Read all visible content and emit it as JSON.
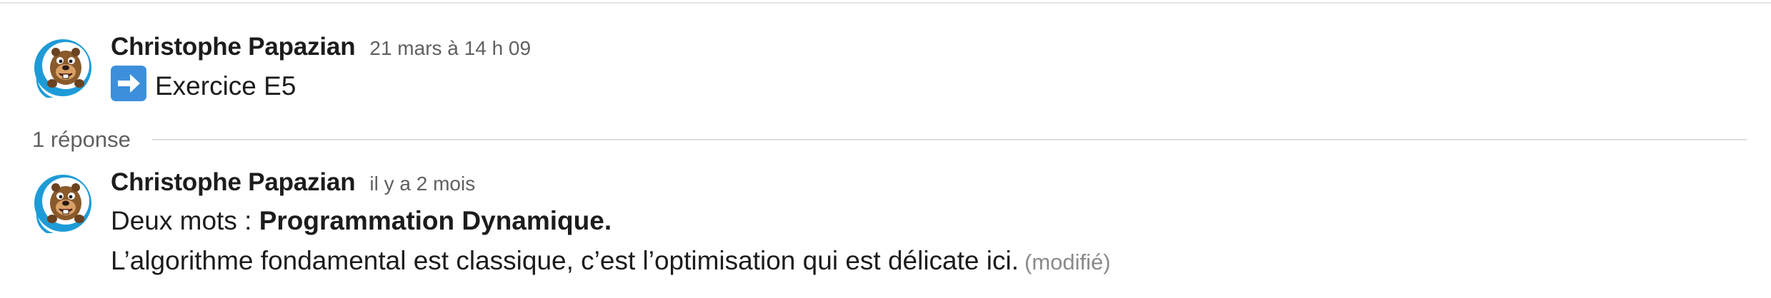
{
  "parent_message": {
    "author": "Christophe Papazian",
    "timestamp": "21 mars à 14 h 09",
    "emoji": "arrow-right-emoji",
    "text": "Exercice E5"
  },
  "thread": {
    "replies_label": "1 réponse"
  },
  "reply_message": {
    "author": "Christophe Papazian",
    "timestamp": "il y a 2 mois",
    "line1_prefix": "Deux mots : ",
    "line1_bold": "Programmation Dynamique.",
    "line2": "L’algorithme fondamental est classique, c’est l’optimisation qui est délicate ici.",
    "edited_label": "(modifié)"
  },
  "colors": {
    "avatar_ring": "#1e9bd7",
    "emoji_blue": "#3d8fdb",
    "timestamp": "#616061",
    "text": "#1d1c1d"
  }
}
